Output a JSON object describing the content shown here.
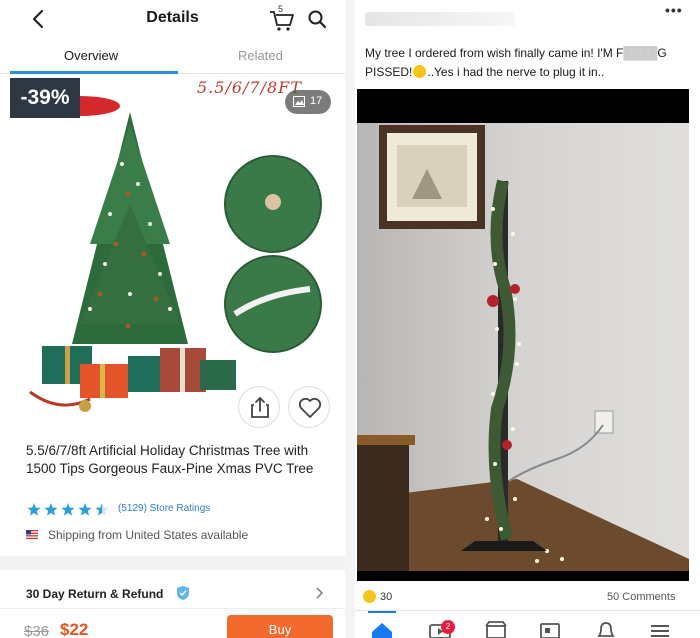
{
  "left": {
    "header": {
      "title": "Details",
      "cart_count": "5"
    },
    "tabs": [
      {
        "label": "Overview"
      },
      {
        "label": "Related"
      }
    ],
    "product": {
      "discount_badge": "-39%",
      "sizes_banner": "5.5/6/7/8FT",
      "photo_count": "17",
      "title": "5.5/6/7/8ft Artificial Holiday Christmas Tree with 1500 Tips Gorgeous Faux-Pine Xmas PVC Tree",
      "rating": 4.5,
      "ratings_text": "(5129) Store Ratings",
      "shipping": "Shipping from United States available",
      "return_policy": "30 Day Return & Refund",
      "price_old": "$36",
      "price_new": "$22",
      "buy_label": "Buy"
    },
    "colors": {
      "accent": "#2a8fd6",
      "price": "#e8531e",
      "buy": "#f26a2e",
      "stars": "#2a9fd8"
    }
  },
  "right": {
    "post": {
      "text_a": "My tree I ordered from wish finally came in! I'M F",
      "text_censor": "████",
      "text_b": "G PISSED!",
      "text_c": "..Yes i had the nerve to plug it in.."
    },
    "reactions": {
      "count": "30"
    },
    "comments": "50 Comments",
    "nav_badge": "2",
    "colors": {
      "accent": "#1877f2",
      "badge": "#e41e3f"
    }
  }
}
